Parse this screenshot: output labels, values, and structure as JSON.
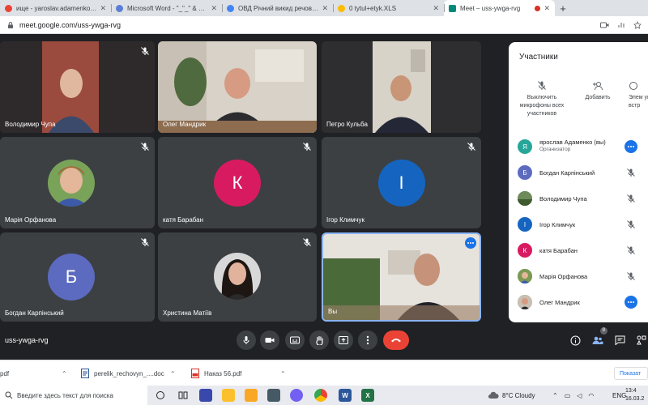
{
  "browser": {
    "tabs": [
      {
        "title": "ище - yaroslav.adamenko@...",
        "color": "#ea4335"
      },
      {
        "title": "Microsoft Word - \"_\"_\" & 0С20...",
        "color": "#5b7fd6"
      },
      {
        "title": "ОВД Річний викид речовин пр...",
        "color": "#4285f4"
      },
      {
        "title": "0 tytul+etyk.XLS",
        "color": "#fbbc04"
      },
      {
        "title": "Meet – uss-ywga-rvg",
        "color": "#00897b",
        "active": true
      }
    ],
    "url": "meet.google.com/uss-ywga-rvg"
  },
  "tiles": [
    {
      "name": "Володимир Чупа"
    },
    {
      "name": "Олег Мандрик"
    },
    {
      "name": "Петро Кульба"
    },
    {
      "name": "Марія Орфанова"
    },
    {
      "name": "катя Барабан",
      "letter": "К",
      "color": "#d81b60"
    },
    {
      "name": "Ігор Климчук",
      "letter": "І",
      "color": "#1565c0"
    },
    {
      "name": "Богдан Карпінський",
      "letter": "Б",
      "color": "#5c6bc0"
    },
    {
      "name": "Христина Матіїв"
    },
    {
      "name": "Вы"
    }
  ],
  "meeting": {
    "code": "uss-ywga-rvg",
    "participants_count": "9"
  },
  "panel": {
    "title": "Участники",
    "actions": [
      {
        "label": "Выключить микрофоны всех участников"
      },
      {
        "label": "Добавить"
      },
      {
        "label": "Элем управ встр"
      }
    ],
    "participants": [
      {
        "name": "ярослав Адаменко (вы)",
        "sub": "Организатор",
        "letter": "Я",
        "color": "#26a69a",
        "state": "more"
      },
      {
        "name": "Богдан Карпінський",
        "letter": "Б",
        "color": "#5c6bc0",
        "state": "muted"
      },
      {
        "name": "Володимир Чупа",
        "letter": "",
        "color": "#6d8a5a",
        "state": "muted"
      },
      {
        "name": "Ігор Климчук",
        "letter": "І",
        "color": "#1565c0",
        "state": "muted"
      },
      {
        "name": "катя Барабан",
        "letter": "К",
        "color": "#d81b60",
        "state": "muted"
      },
      {
        "name": "Марія Орфанова",
        "letter": "",
        "color": "#7a9a55",
        "state": "muted"
      },
      {
        "name": "Олег Мандрик",
        "letter": "",
        "color": "#8a7a6a",
        "state": "more"
      }
    ]
  },
  "downloads": {
    "items": [
      {
        "name": "pdf"
      },
      {
        "name": "perelik_rechovyn_....doc"
      },
      {
        "name": "Наказ 56.pdf"
      }
    ],
    "show_all": "Показат"
  },
  "taskbar": {
    "search_placeholder": "Введите здесь текст для поиска",
    "weather": "8°C  Cloudy",
    "lang": "ENG",
    "time": "13:4",
    "date": "16.03.2"
  }
}
